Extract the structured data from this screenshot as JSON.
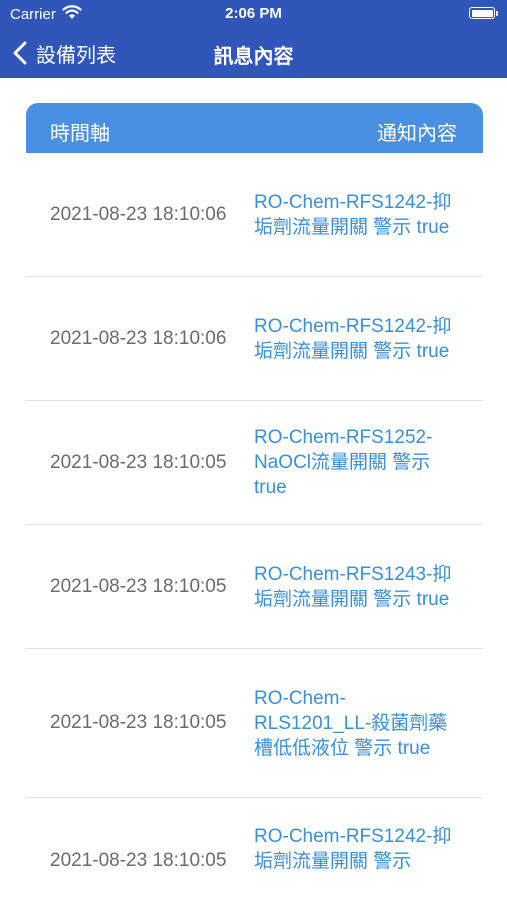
{
  "status_bar": {
    "carrier": "Carrier",
    "time": "2:06 PM"
  },
  "nav": {
    "back_label": "設備列表",
    "title": "訊息內容"
  },
  "table": {
    "header_time": "時間軸",
    "header_content": "通知內容",
    "rows": [
      {
        "time": "2021-08-23 18:10:06",
        "message": "RO-Chem-RFS1242-抑垢劑流量開關 警示 true"
      },
      {
        "time": "2021-08-23 18:10:06",
        "message": "RO-Chem-RFS1242-抑垢劑流量開關 警示 true"
      },
      {
        "time": "2021-08-23 18:10:05",
        "message": "RO-Chem-RFS1252-NaOCl流量開關 警示 true"
      },
      {
        "time": "2021-08-23 18:10:05",
        "message": "RO-Chem-RFS1243-抑垢劑流量開關 警示 true"
      },
      {
        "time": "2021-08-23 18:10:05",
        "message": "RO-Chem-RLS1201_LL-殺菌劑藥槽低低液位 警示 true"
      },
      {
        "time": "2021-08-23 18:10:05",
        "message": "RO-Chem-RFS1242-抑垢劑流量開關 警示"
      }
    ]
  },
  "colors": {
    "nav_background": "#2f56b8",
    "header_background": "#4a90e2",
    "message_text": "#3a8fd9",
    "timestamp_text": "#6b6b6b"
  },
  "icons": {
    "wifi": "wifi-icon",
    "battery": "battery-icon",
    "back": "chevron-left-icon"
  }
}
